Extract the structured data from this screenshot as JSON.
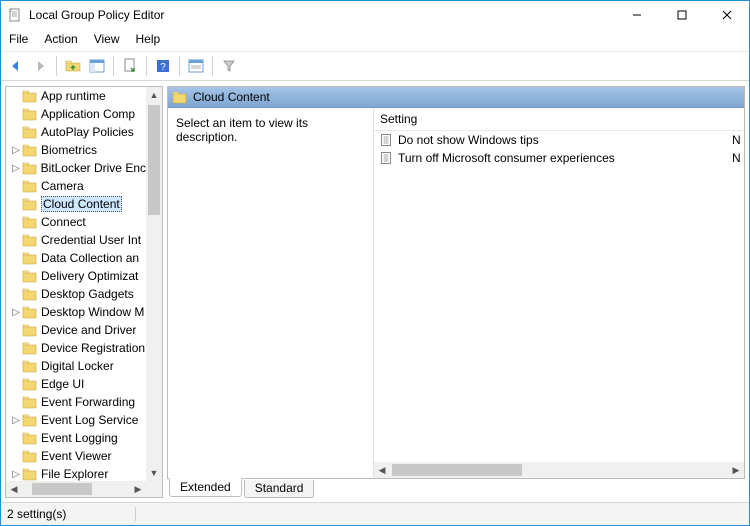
{
  "window": {
    "title": "Local Group Policy Editor"
  },
  "menu": {
    "file": "File",
    "action": "Action",
    "view": "View",
    "help": "Help"
  },
  "tree": {
    "items": [
      {
        "label": "App runtime",
        "expandable": false
      },
      {
        "label": "Application Comp",
        "expandable": false
      },
      {
        "label": "AutoPlay Policies",
        "expandable": false
      },
      {
        "label": "Biometrics",
        "expandable": true
      },
      {
        "label": "BitLocker Drive Enc",
        "expandable": true
      },
      {
        "label": "Camera",
        "expandable": false
      },
      {
        "label": "Cloud Content",
        "expandable": false,
        "selected": true
      },
      {
        "label": "Connect",
        "expandable": false
      },
      {
        "label": "Credential User Int",
        "expandable": false
      },
      {
        "label": "Data Collection an",
        "expandable": false
      },
      {
        "label": "Delivery Optimizat",
        "expandable": false
      },
      {
        "label": "Desktop Gadgets",
        "expandable": false
      },
      {
        "label": "Desktop Window M",
        "expandable": true
      },
      {
        "label": "Device and Driver",
        "expandable": false
      },
      {
        "label": "Device Registration",
        "expandable": false
      },
      {
        "label": "Digital Locker",
        "expandable": false
      },
      {
        "label": "Edge UI",
        "expandable": false
      },
      {
        "label": "Event Forwarding",
        "expandable": false
      },
      {
        "label": "Event Log Service",
        "expandable": true
      },
      {
        "label": "Event Logging",
        "expandable": false
      },
      {
        "label": "Event Viewer",
        "expandable": false
      },
      {
        "label": "File Explorer",
        "expandable": true
      }
    ]
  },
  "content": {
    "heading": "Cloud Content",
    "description_prompt": "Select an item to view its description.",
    "column_setting": "Setting",
    "settings": [
      {
        "name": "Do not show Windows tips",
        "state": "N"
      },
      {
        "name": "Turn off Microsoft consumer experiences",
        "state": "N"
      }
    ]
  },
  "tabs": {
    "extended": "Extended",
    "standard": "Standard"
  },
  "status": {
    "text": "2 setting(s)"
  }
}
